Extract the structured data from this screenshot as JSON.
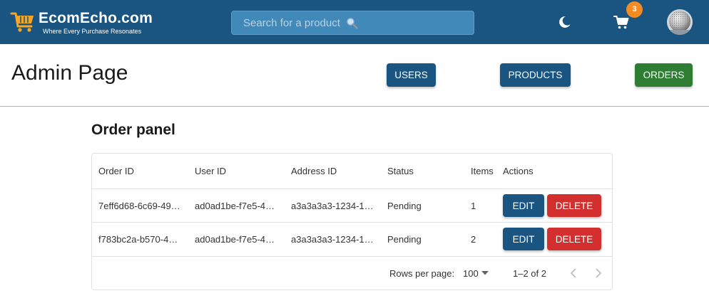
{
  "header": {
    "brand_name": "EcomEcho.com",
    "tagline": "Where Every Purchase Resonates",
    "search_placeholder": "Search for a product",
    "cart_count": "3",
    "icons": [
      "cart-logo-icon",
      "search-icon",
      "moon-icon",
      "cart-icon",
      "avatar-icon"
    ],
    "colors": {
      "bar": "#195580",
      "badge": "#f28b22",
      "logo_cart": "#f5a623"
    }
  },
  "page": {
    "title": "Admin Page",
    "nav": {
      "users": "USERS",
      "products": "PRODUCTS",
      "orders": "ORDERS"
    },
    "colors": {
      "primary": "#195580",
      "active": "#2e7d32",
      "divider": "#e0b74a"
    }
  },
  "panel": {
    "title": "Order panel",
    "columns": [
      "Order ID",
      "User ID",
      "Address ID",
      "Status",
      "Items",
      "Actions"
    ],
    "rows": [
      {
        "order_id": "7eff6d68-6c69-49…",
        "user_id": "ad0ad1be-f7e5-4…",
        "address_id": "a3a3a3a3-1234-12…",
        "status": "Pending",
        "items": "1"
      },
      {
        "order_id": "f783bc2a-b570-4…",
        "user_id": "ad0ad1be-f7e5-4…",
        "address_id": "a3a3a3a3-1234-12…",
        "status": "Pending",
        "items": "2"
      }
    ],
    "actions": {
      "edit": "EDIT",
      "delete": "DELETE"
    },
    "colors": {
      "edit": "#195580",
      "delete": "#d32f2f"
    },
    "pagination": {
      "label": "Rows per page:",
      "rows_per_page": "100",
      "range": "1–2 of 2"
    }
  }
}
